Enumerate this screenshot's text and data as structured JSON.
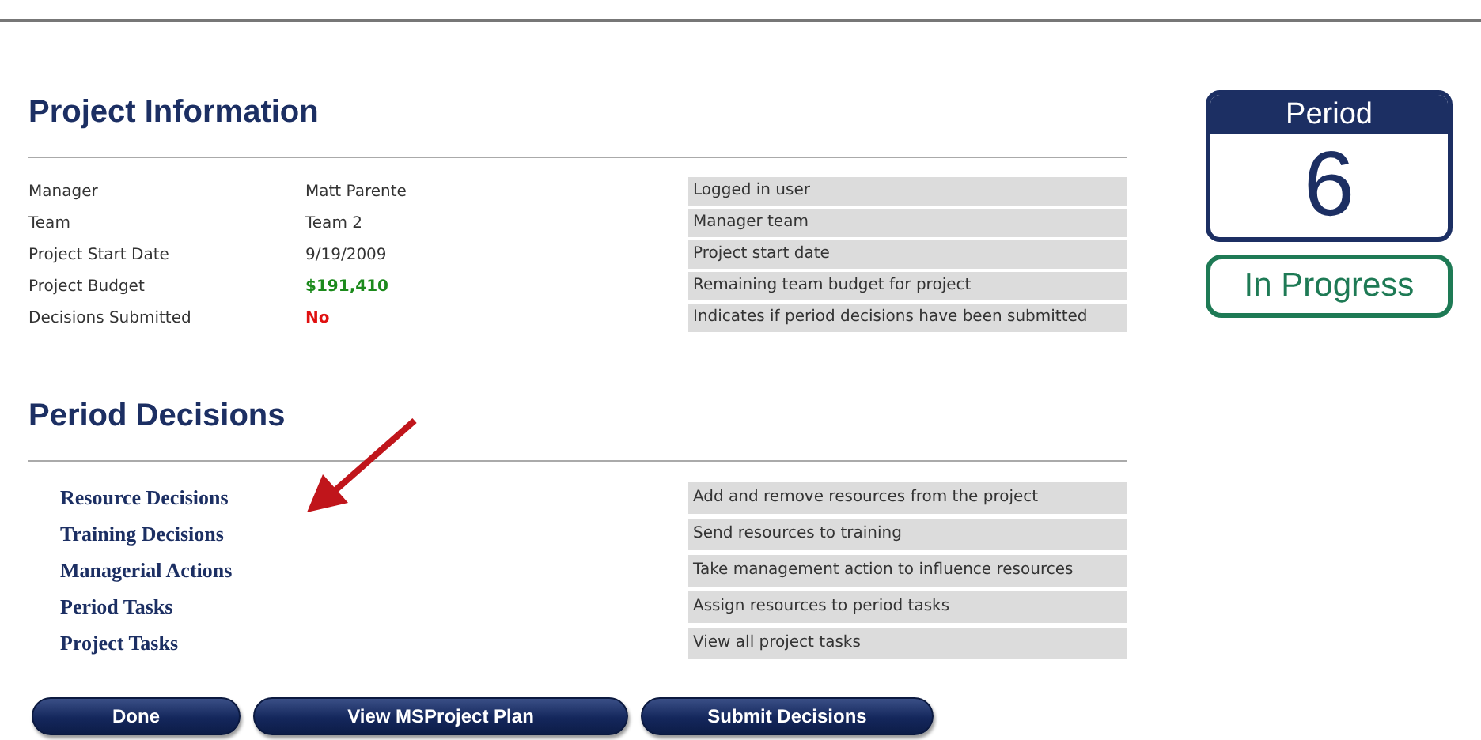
{
  "project_information": {
    "title": "Project Information",
    "rows": [
      {
        "label": "Manager",
        "value": "Matt Parente",
        "kind": "plain",
        "description": "Logged in user"
      },
      {
        "label": "Team",
        "value": "Team 2",
        "kind": "plain",
        "description": "Manager team"
      },
      {
        "label": "Project Start Date",
        "value": "9/19/2009",
        "kind": "plain",
        "description": "Project start date"
      },
      {
        "label": "Project Budget",
        "value": "$191,410",
        "kind": "positive",
        "description": "Remaining team budget for project"
      },
      {
        "label": "Decisions Submitted",
        "value": "No",
        "kind": "negative",
        "description": "Indicates if period decisions have been submitted"
      }
    ]
  },
  "period_decisions": {
    "title": "Period Decisions",
    "items": [
      {
        "link": "Resource Decisions",
        "description": "Add and remove resources from the project"
      },
      {
        "link": "Training Decisions",
        "description": "Send resources to training"
      },
      {
        "link": "Managerial Actions",
        "description": "Take management action to influence resources"
      },
      {
        "link": "Period Tasks",
        "description": "Assign resources to period tasks"
      },
      {
        "link": "Project Tasks",
        "description": "View all project tasks"
      }
    ]
  },
  "buttons": [
    "Done",
    "View MSProject Plan",
    "Submit Decisions"
  ],
  "period_badge": {
    "label": "Period",
    "number": "6",
    "status": "In Progress"
  }
}
